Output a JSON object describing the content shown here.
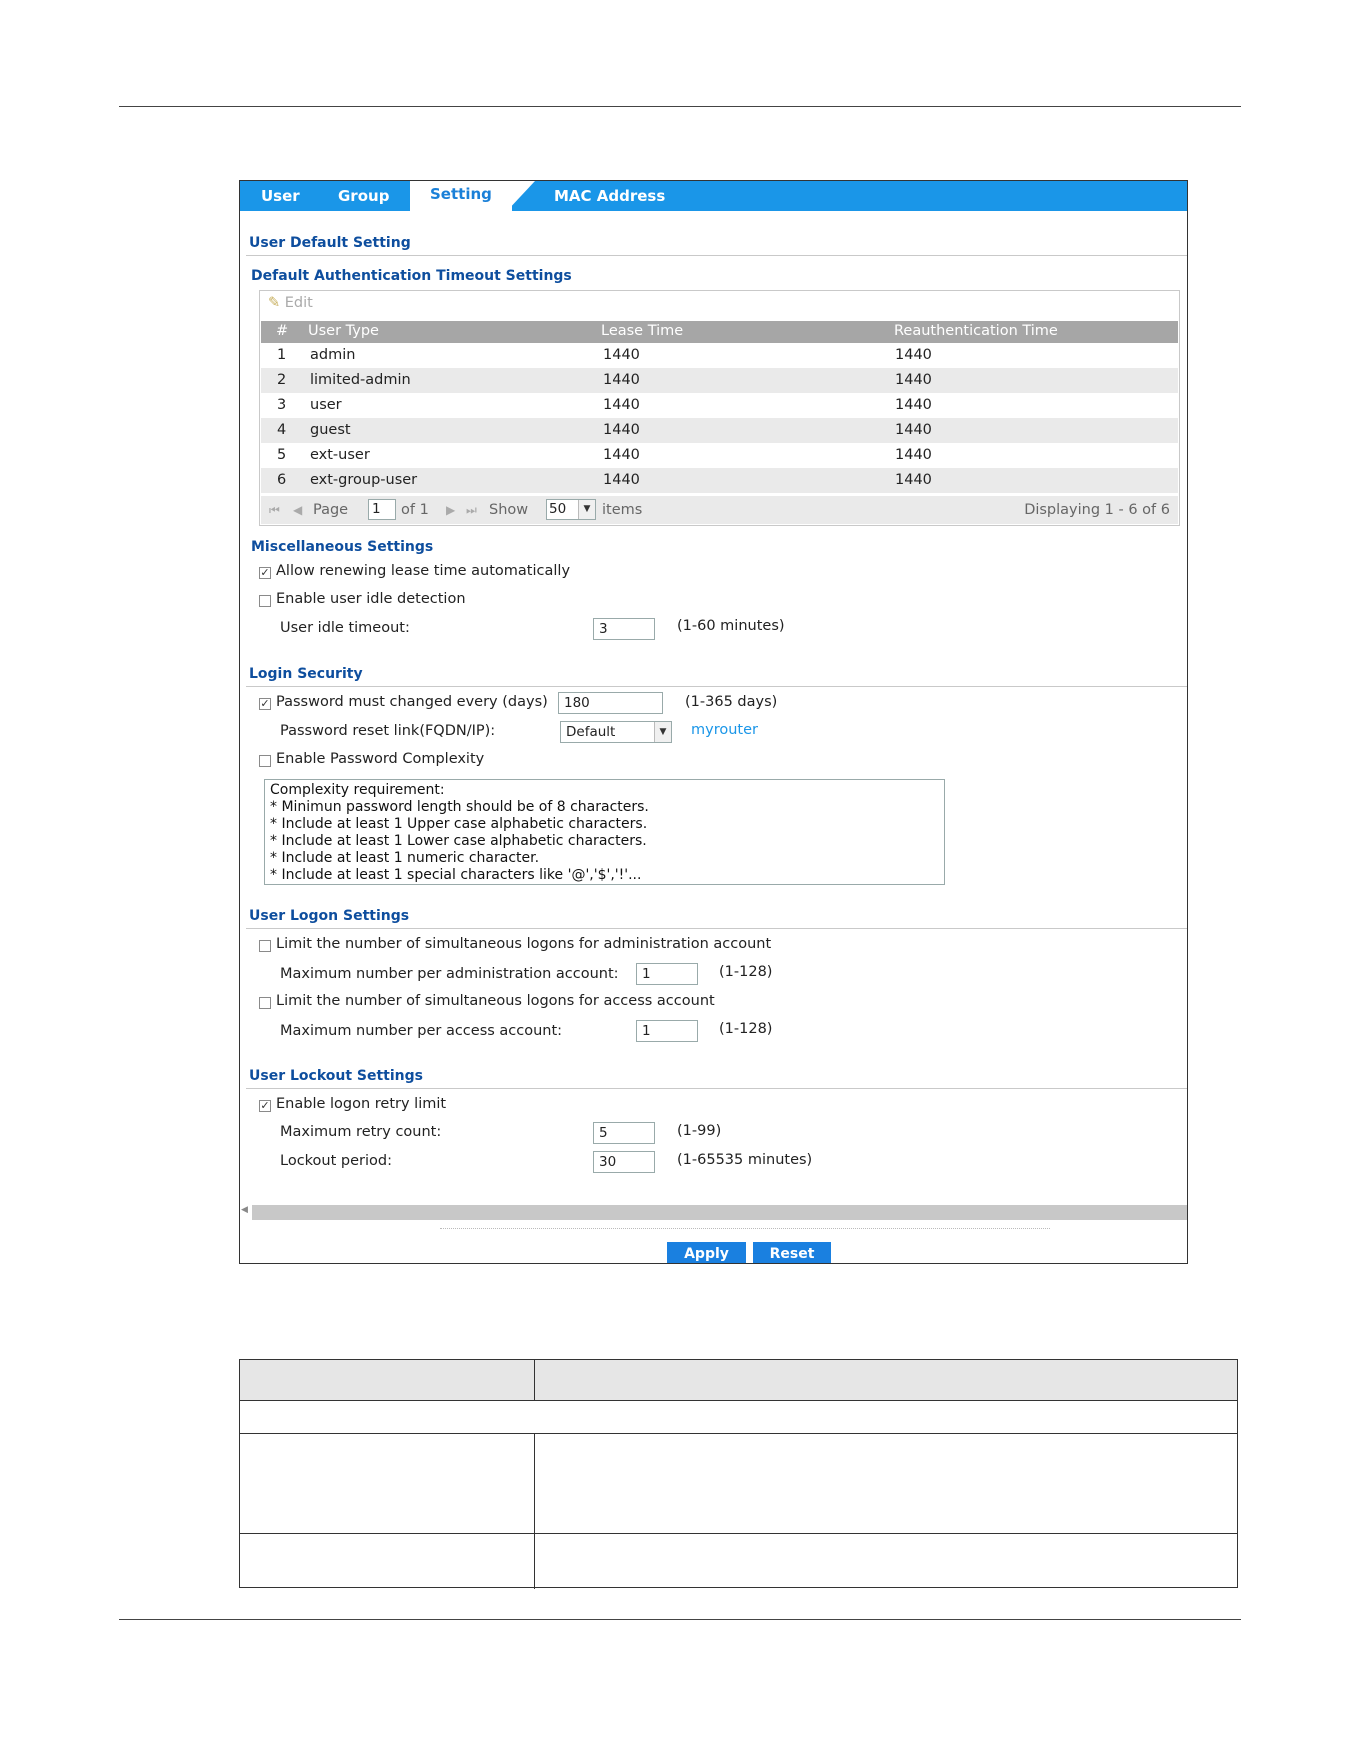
{
  "tabs": {
    "user": "User",
    "group": "Group",
    "setting": "Setting",
    "mac": "MAC Address"
  },
  "user_default": {
    "title": "User Default Setting",
    "subtitle": "Default Authentication Timeout Settings",
    "edit_label": "Edit",
    "columns": [
      "#",
      "User Type",
      "Lease Time",
      "Reauthentication Time"
    ],
    "rows": [
      {
        "num": "1",
        "type": "admin",
        "lease": "1440",
        "reauth": "1440"
      },
      {
        "num": "2",
        "type": "limited-admin",
        "lease": "1440",
        "reauth": "1440"
      },
      {
        "num": "3",
        "type": "user",
        "lease": "1440",
        "reauth": "1440"
      },
      {
        "num": "4",
        "type": "guest",
        "lease": "1440",
        "reauth": "1440"
      },
      {
        "num": "5",
        "type": "ext-user",
        "lease": "1440",
        "reauth": "1440"
      },
      {
        "num": "6",
        "type": "ext-group-user",
        "lease": "1440",
        "reauth": "1440"
      }
    ],
    "pager": {
      "page_label": "Page",
      "page_value": "1",
      "of_label": "of 1",
      "show_label": "Show",
      "show_value": "50",
      "items_label": "items",
      "displaying": "Displaying 1 - 6 of 6"
    }
  },
  "misc": {
    "title": "Miscellaneous Settings",
    "allow_renew_label": "Allow renewing lease time automatically",
    "allow_renew_checked": true,
    "idle_detect_label": "Enable user idle detection",
    "idle_detect_checked": false,
    "idle_timeout_label": "User idle timeout:",
    "idle_timeout_value": "3",
    "idle_timeout_range": "(1-60 minutes)"
  },
  "login_security": {
    "title": "Login Security",
    "pw_change_label": "Password must changed every (days)",
    "pw_change_checked": true,
    "pw_change_value": "180",
    "pw_change_range": "(1-365 days)",
    "reset_link_label": "Password reset link(FQDN/IP):",
    "reset_link_value": "Default",
    "reset_link_host": "myrouter",
    "complexity_label": "Enable Password Complexity",
    "complexity_checked": false,
    "complexity_lines": [
      "Complexity requirement:",
      "* Minimun password length should be of 8 characters.",
      "* Include at least 1 Upper case alphabetic characters.",
      "* Include at least 1 Lower case alphabetic characters.",
      "* Include at least 1 numeric character.",
      "* Include at least 1 special characters like '@','$','!'..."
    ]
  },
  "logon": {
    "title": "User Logon Settings",
    "admin_limit_label": "Limit the number of simultaneous logons for administration account",
    "admin_limit_checked": false,
    "admin_max_label": "Maximum number per administration account:",
    "admin_max_value": "1",
    "admin_max_range": "(1-128)",
    "access_limit_label": "Limit the number of simultaneous logons for access account",
    "access_limit_checked": false,
    "access_max_label": "Maximum number per access account:",
    "access_max_value": "1",
    "access_max_range": "(1-128)"
  },
  "lockout": {
    "title": "User Lockout Settings",
    "retry_limit_label": "Enable logon retry limit",
    "retry_limit_checked": true,
    "retry_count_label": "Maximum retry count:",
    "retry_count_value": "5",
    "retry_count_range": "(1-99)",
    "lockout_period_label": "Lockout period:",
    "lockout_period_value": "30",
    "lockout_period_range": "(1-65535 minutes)"
  },
  "buttons": {
    "apply": "Apply",
    "reset": "Reset"
  },
  "colors": {
    "tab_bar": "#1a96e8",
    "section_title": "#0e4e9e",
    "button": "#1a80e0",
    "link": "#1a96e8"
  }
}
